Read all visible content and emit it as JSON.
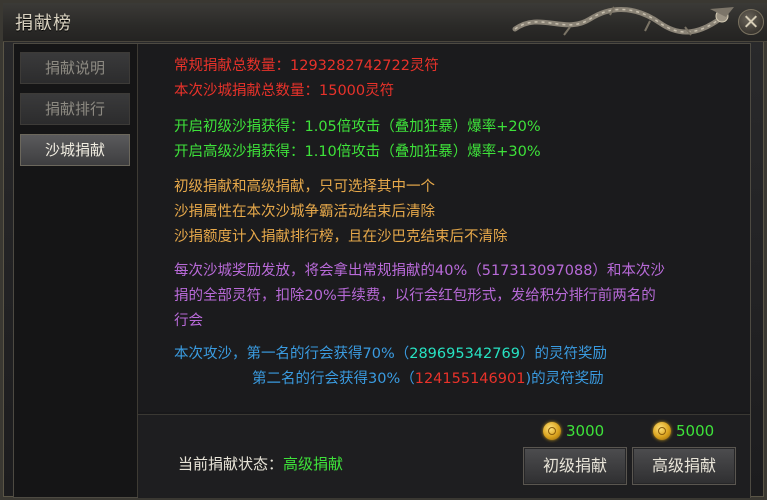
{
  "window": {
    "title": "捐献榜"
  },
  "sidebar": {
    "items": [
      {
        "label": "捐献说明",
        "active": false
      },
      {
        "label": "捐献排行",
        "active": false
      },
      {
        "label": "沙城捐献",
        "active": true
      }
    ]
  },
  "content": {
    "total_line": "常规捐献总数量：1293282742722灵符",
    "current_line": "本次沙城捐献总数量：15000灵符",
    "basic_bonus": "开启初级沙捐获得：1.05倍攻击（叠加狂暴）爆率+20%",
    "advanced_bonus": "开启高级沙捐获得：1.10倍攻击（叠加狂暴）爆率+30%",
    "rule_1": "初级捐献和高级捐献，只可选择其中一个",
    "rule_2": "沙捐属性在本次沙城争霸活动结束后清除",
    "rule_3": "沙捐额度计入捐献排行榜，且在沙巴克结束后不清除",
    "reward_p1": "每次沙城奖励发放，将会拿出常规捐献的40%（517313097088）和本次沙",
    "reward_p2": "捐的全部灵符，扣除20%手续费，以行会红包形式，发给积分排行前两名的",
    "reward_p3": "行会",
    "first_pre": "本次攻沙，第一名的行会获得70%（",
    "first_amount": "289695342769",
    "first_post": "）的灵符奖励",
    "second_pre": "第二名的行会获得30%（",
    "second_amount": "124155146901",
    "second_post": ")的灵符奖励"
  },
  "bottom": {
    "status_label": "当前捐献状态：",
    "status_value": "高级捐献",
    "basic_cost": "3000",
    "advanced_cost": "5000",
    "basic_button": "初级捐献",
    "advanced_button": "高级捐献"
  },
  "colors": {
    "red": "#e8322a",
    "green": "#3ee23a",
    "orange": "#e6a84a",
    "purple": "#b86ad8",
    "blue": "#3a9be0",
    "cyan": "#27e2c2"
  }
}
